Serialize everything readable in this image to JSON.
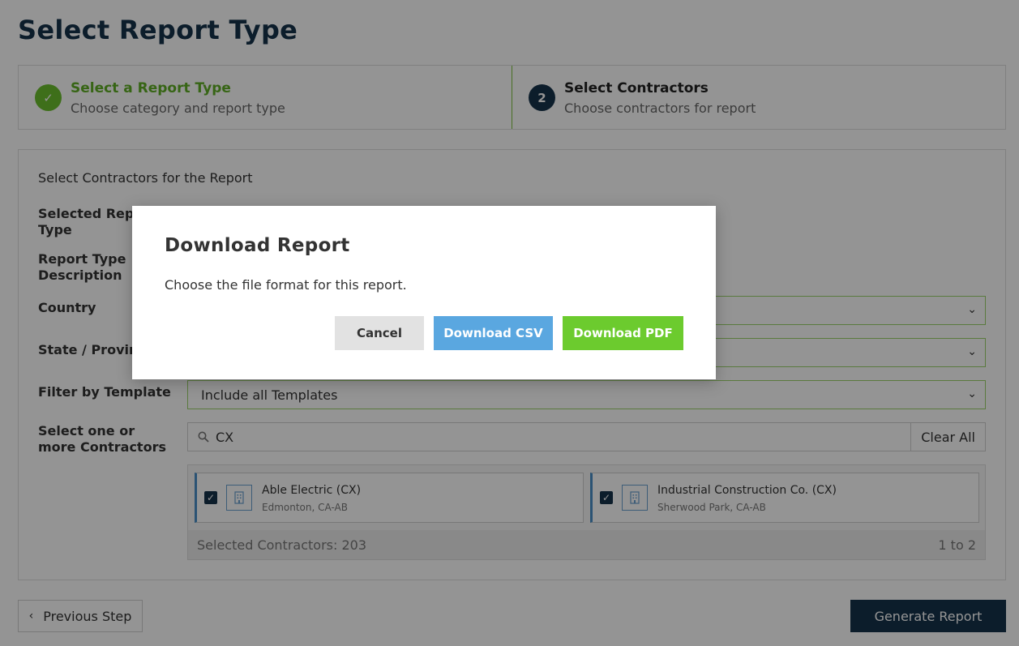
{
  "page": {
    "title": "Select Report Type"
  },
  "stepper": {
    "steps": [
      {
        "marker": "✓",
        "title": "Select a Report Type",
        "subtitle": "Choose category and report type"
      },
      {
        "marker": "2",
        "title": "Select Contractors",
        "subtitle": "Choose contractors for report"
      }
    ]
  },
  "form": {
    "heading": "Select Contractors for the Report",
    "labels": {
      "selected_report_type": "Selected Report Type",
      "report_type_description": "Report Type Description",
      "country": "Country",
      "state_province": "State / Province",
      "filter_by_template": "Filter by Template",
      "select_contractors": "Select one or more Contractors"
    },
    "country_value": "",
    "state_value": "",
    "template_value": "Include all Templates",
    "search": {
      "value": "CX",
      "clear_label": "Clear All"
    },
    "contractors": [
      {
        "name": "Able Electric (CX)",
        "location": "Edmonton, CA-AB",
        "checked": true
      },
      {
        "name": "Industrial Construction Co. (CX)",
        "location": "Sherwood Park, CA-AB",
        "checked": true
      }
    ],
    "selected_count_label": "Selected Contractors: 203",
    "range_label": "1 to 2"
  },
  "footer": {
    "previous_label": "Previous Step",
    "generate_label": "Generate Report"
  },
  "modal": {
    "title": "Download Report",
    "text": "Choose the file format for this report.",
    "cancel_label": "Cancel",
    "csv_label": "Download CSV",
    "pdf_label": "Download PDF"
  },
  "colors": {
    "navy": "#16324a",
    "green": "#6cbf2e",
    "csv_blue": "#5aa7e0",
    "pdf_green": "#6ccb2e"
  }
}
